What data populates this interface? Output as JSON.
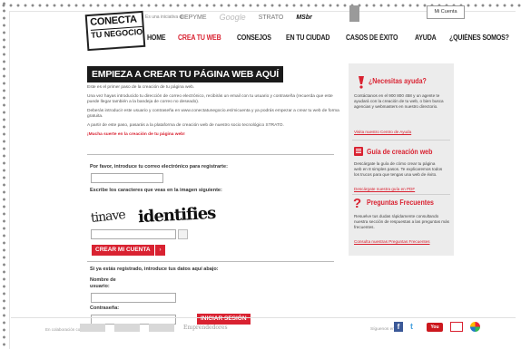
{
  "header": {
    "logo_line1": "CONECTA",
    "logo_line2": "TU NEGOCIO",
    "initiative_text": "Es una iniciativa de:",
    "partners": [
      "CEPYME",
      "Google",
      "STRATO",
      "MSbr"
    ],
    "account_button": "Mi Cuenta"
  },
  "nav": {
    "items": [
      "HOME",
      "CREA TU WEB",
      "CONSEJOS",
      "EN TU CIUDAD",
      "CASOS DE ÉXITO",
      "AYUDA",
      "¿QUIÉNES SOMOS?"
    ],
    "active_index": 1
  },
  "main": {
    "title": "EMPIEZA A CREAR TU PÁGINA WEB AQUÍ",
    "intro": [
      "Este es el primer paso de la creación de tu página web.",
      "Una vez hayas introducido tu dirección de correo electrónico, recibirás un email con tu usuario y contraseña (recuerda que este puede llegar también a la bandeja de correo no deseado).",
      "Deberás introducir este usuario y contraseña en www.conectatunegocio.es/micuenta y ya podrás empezar a crear tu web de forma gratuita.",
      "A partir de este paso, pasarás a la plataforma de creación web de nuestro socio tecnológico STRATO."
    ],
    "luck_text": "¡Mucha suerte en la creación de tu página web!",
    "register": {
      "email_label": "Por favor, introduce tu correo electrónico para registrarte:",
      "captcha_label": "Escribe los caracteres que veas en la imagen siguiente:",
      "captcha_word1": "tinave",
      "captcha_word2": "identifies",
      "create_button": "CREAR MI CUENTA",
      "arrow": "›"
    },
    "login": {
      "heading": "Si ya estás registrado, introduce tus datos aquí abajo:",
      "username_label_1": "Nombre de",
      "username_label_2": "usuario:",
      "password_label": "Contraseña:",
      "login_button": "INICIAR SESIÓN"
    }
  },
  "sidebar": {
    "help": {
      "title": "¿Necesitas ayuda?",
      "text": "Contáctanos en el 900 800 458 y un agente te ayudará con la creación de tu web, o bien busca agencias y webmasters en nuestro directorio.",
      "link": "Visita nuestro Centro de Ayuda"
    },
    "guide": {
      "title": "Guía de creación web",
      "text": "Descárgate la guía de cómo crear tu página web en 8 simples pasos. Te explicaremos todos los trucos para que tengas una web de éxito.",
      "link": "Descárgate nuestra guía en PDF"
    },
    "faq": {
      "title": "Preguntas Frecuentes",
      "text": "Resuelve tus dudas rápidamente consultando nuestra sección de respuestas a las preguntas más frecuentes.",
      "link": "Consulta nuestras Preguntas Frecuentes"
    }
  },
  "footer": {
    "collab_text": "En colaboración con:",
    "empr_text": "Emprendedores",
    "follow_text": "Síguenos en:",
    "social": [
      "facebook-icon",
      "twitter-icon",
      "youtube-icon",
      "mail-icon",
      "flickr-icon"
    ],
    "youtube_label": "You Tube"
  },
  "colors": {
    "accent": "#d92231",
    "dark": "#1a1a1a",
    "sidebar_bg": "#ececec"
  }
}
